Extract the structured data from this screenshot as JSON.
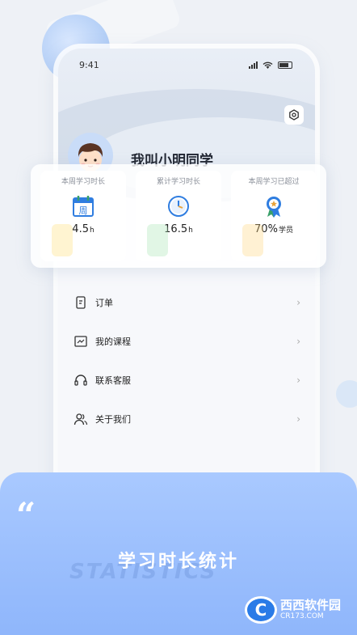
{
  "status_bar": {
    "time": "9:41"
  },
  "profile": {
    "username": "我叫小明同学"
  },
  "stats": [
    {
      "label": "本周学习时长",
      "value": "4.5",
      "unit": "h",
      "icon": "calendar-week-icon",
      "color": "#3aa06a"
    },
    {
      "label": "累计学习时长",
      "value": "16.5",
      "unit": "h",
      "icon": "clock-icon",
      "color": "#2f7de0"
    },
    {
      "label": "本周学习已超过",
      "value": "70%",
      "unit": "学员",
      "icon": "medal-icon",
      "color": "#e8a33b"
    }
  ],
  "menu": [
    {
      "label": "订单",
      "icon": "order-icon"
    },
    {
      "label": "我的课程",
      "icon": "course-icon"
    },
    {
      "label": "联系客服",
      "icon": "headset-icon"
    },
    {
      "label": "关于我们",
      "icon": "users-icon"
    }
  ],
  "banner": {
    "quote_mark": "“",
    "title": "学习时长统计",
    "ghost_text": "STATISTICS"
  },
  "watermark": {
    "logo_text": "C",
    "brand": "西西软件园",
    "url": "CR173.COM"
  }
}
